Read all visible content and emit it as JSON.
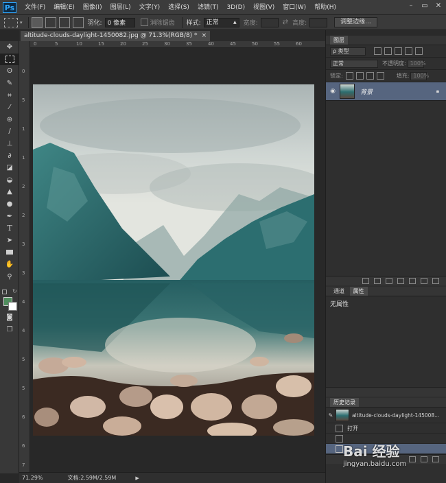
{
  "app": {
    "logo": "Ps"
  },
  "menu": [
    "文件(F)",
    "编辑(E)",
    "图像(I)",
    "图层(L)",
    "文字(Y)",
    "选择(S)",
    "滤镜(T)",
    "3D(D)",
    "视图(V)",
    "窗口(W)",
    "帮助(H)"
  ],
  "window_controls": {
    "minimize": "–",
    "restore": "▭",
    "close": "✕"
  },
  "options": {
    "feather_label": "羽化:",
    "feather_value": "0 像素",
    "antialias_label": "消除锯齿",
    "style_label": "样式:",
    "style_value": "正常",
    "width_label": "宽度:",
    "height_label": "高度:",
    "refine_button": "调整边缘..."
  },
  "document": {
    "tab_title": "altitude-clouds-daylight-1450082.jpg @ 71.3%(RGB/8) *",
    "close": "×",
    "zoom": "71.29%",
    "doc_info": "文档:2.59M/2.59M"
  },
  "ruler": {
    "top": [
      "0",
      "5",
      "10",
      "15",
      "20",
      "25",
      "30",
      "35",
      "40",
      "45",
      "50",
      "55",
      "60"
    ],
    "left": [
      "0",
      "5",
      "1",
      "1",
      "2",
      "2",
      "3",
      "3",
      "4",
      "4",
      "5",
      "5",
      "6",
      "6",
      "7"
    ]
  },
  "layers_panel": {
    "title": "图层",
    "filter_value": "ρ 类型",
    "blend_mode": "正常",
    "opacity_label": "不透明度:",
    "opacity_value": "100%",
    "lock_label": "锁定:",
    "fill_label": "填充:",
    "fill_value": "100%",
    "layer_name": "背景"
  },
  "props_panel": {
    "tab_channels": "通道",
    "tab_properties": "属性",
    "content": "无属性"
  },
  "history_panel": {
    "title": "历史记录",
    "snapshot": "altitude-clouds-daylight-145008...",
    "items": [
      "打开",
      "",
      ""
    ]
  },
  "watermark": {
    "text": "Bai 经验",
    "url": "jingyan.baidu.com"
  }
}
